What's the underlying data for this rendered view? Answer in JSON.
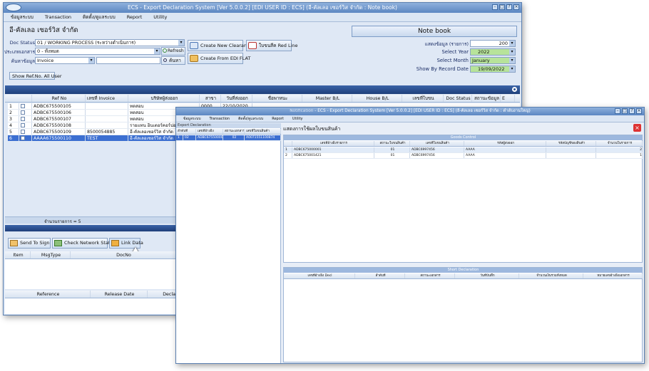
{
  "main": {
    "title": "ECS - Export Declaration System [Ver 5.0.0.2] [EDI USER ID : ECS] (อี-คัลเลอ เซอร์วิส จำกัด : Note book)",
    "menu": [
      "ข้อมูลระบบ",
      "Transaction",
      "ติดตั้ง/ดูแลระบบ",
      "Report",
      "Utility"
    ],
    "company": "อี-คัลเลอ เซอร์วิส จำกัด",
    "notebook": "Note book",
    "doc_status_label": "Doc Status",
    "doc_status_value": "01 / WORKING PROCESS (ระหว่างดำเนินการ)",
    "field2_label": "ประเภทเอกสาร",
    "field2_value": "0 - ทั้งหมด",
    "field3_label": "ค้นหาข้อมูล",
    "field3_value": "Invoice",
    "refresh": "Refresh",
    "search": "ค้นหา",
    "create_clearance": "Create New Clearance",
    "red_line": "ใบขนสีค Red Line",
    "create_edi": "Create From EDI FLAT",
    "records_label": "แสดงข้อมูล (รายการ)",
    "records_value": "200",
    "year_label": "Select Year",
    "year_value": "2022",
    "month_label": "Select Month",
    "month_value": "January",
    "date_label": "Show By Record Date",
    "date_value": "19/09/2022",
    "show_all": "Show Ref.No. All User",
    "grid_cols": [
      "Ref No",
      "เลขที่ Invoice",
      "บริษัทผู้ส่งออก",
      "สาขา",
      "วันที่ส่งออก",
      "ชื่อพาหนะ",
      "Master B/L",
      "House B/L",
      "เลขที่ใบขน",
      "Doc Status",
      "สถานะข้อมูล",
      "E"
    ],
    "rows": [
      {
        "n": "1",
        "ref": "ADBC675500105",
        "inv": "",
        "co": "ทดสอบ",
        "br": "0000",
        "dt": "22/10/2020",
        "st": "01",
        "sd": "SA1"
      },
      {
        "n": "2",
        "ref": "ADBC675500106",
        "inv": "",
        "co": "ทดสอบ",
        "br": "",
        "dt": "",
        "st": "",
        "sd": ""
      },
      {
        "n": "3",
        "ref": "ADBC675500107",
        "inv": "",
        "co": "ทดสอบ",
        "br": "",
        "dt": "",
        "st": "",
        "sd": ""
      },
      {
        "n": "4",
        "ref": "ADBC675500108",
        "inv": "",
        "co": "รายแทน อินเตอร์คอร์ปอร์เรท",
        "br": "",
        "dt": "",
        "st": "",
        "sd": ""
      },
      {
        "n": "5",
        "ref": "ADBC675500109",
        "inv": "8500054885",
        "co": "อี-คัลเลอเซอร์วิส จำกัด",
        "br": "",
        "dt": "",
        "st": "",
        "sd": ""
      },
      {
        "n": "6",
        "ref": "AAAA675500110",
        "inv": "TEST",
        "co": "อี-คัลเลอเซอร์วิส จำกัด",
        "br": "",
        "dt": "",
        "st": "",
        "sd": ""
      }
    ],
    "count_label": "จำนวนรายการ = 5",
    "send_sign": "Send To Sign",
    "check_net": "Check Network Status",
    "link_data": "Link Data",
    "msg_cols": [
      "Item",
      "MsgType",
      "DocNo"
    ],
    "ref_cols": [
      "Reference",
      "Release Date",
      "Decla"
    ]
  },
  "child": {
    "title": "ECS - Export Declaration System [Ver 5.0.0.2] [EDI USER ID : ECS] (อี-คัลเลอ เซอร์วิส จำกัด : ตำดับงานใหญ่)",
    "title_prefix": "Notification",
    "menu": [
      "ข้อมูลระบบ",
      "Transaction",
      "ติดตั้ง/ดูแลระบบ",
      "Report",
      "Utility"
    ],
    "left_panel": "Export Declaration",
    "left_cols": [
      "ลำดับที่",
      "เลขที่อ้างอิง",
      "สถานะเอกสาร",
      "เลขที่ใบขนสินค้า"
    ],
    "left_row": {
      "n": "1",
      "a": "02",
      "b": "ADBC675500001",
      "c": "02",
      "d": "A0071551100874"
    },
    "heading": "แสดงการใช้ผลใบขนสินค้า",
    "goods_title": "Goods Control",
    "goods_cols": [
      "เลขที่อ้างอิงรายการ",
      "สถานะใบขนสินค้า",
      "เลขที่ใบขนสินค้า",
      "รหัสผู้ส่งออก",
      "รหัสบัญชีของสินค้า",
      "จำนวนในรายการ"
    ],
    "goods_rows": [
      {
        "n": "1",
        "a": "ADBC675000001",
        "b": "01",
        "c": "ADBC6997456",
        "d": "AAAA",
        "e": "2"
      },
      {
        "n": "2",
        "a": "ADBC675001421",
        "b": "01",
        "c": "ADBC6997456",
        "d": "AAAA",
        "e": "1"
      }
    ],
    "short_title": "Short Declaration",
    "short_cols": [
      "เลขที่อ้างอิง Decl",
      "ลำดับที่",
      "สถานะเอกสาร",
      "วันที่บันทึก",
      "จำนวนเงินรวมทั้งหมด",
      "หมายเลขอ้างอิงเอกสาร"
    ]
  }
}
